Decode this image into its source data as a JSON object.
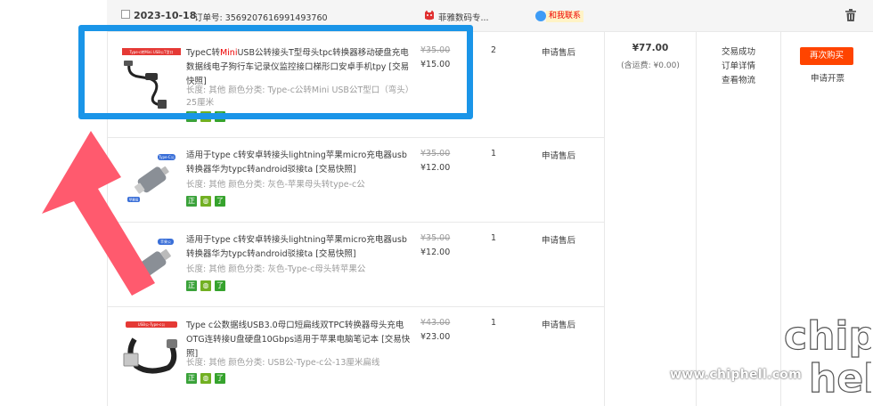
{
  "order": {
    "date": "2023-10-18",
    "number_label": "订单号: 3569207616991493760",
    "shop_name": "菲雅数码专...",
    "contact_label": "和我联系",
    "total": "¥77.00",
    "shipping": "(含运费: ¥0.00)",
    "status_lines": [
      "交易成功",
      "订单详情",
      "查看物流"
    ],
    "rebuy_label": "再次购买",
    "invoice_label": "申请开票"
  },
  "items": [
    {
      "title_pre": "TypeC转",
      "title_hl": "Mini",
      "title_post": "USB公转接头T型母头tpc转换器移动硬盘充电数据线电子狗行车记录仪监控接口梯形口安卓手机tpy [交易快照]",
      "spec": "长度: 其他  颜色分类: Type-c公转Mini USB公T型口（弯头）25厘米",
      "orig_price": "¥35.00",
      "price": "¥15.00",
      "qty": "2",
      "after_sale": "申请售后"
    },
    {
      "title_pre": "适用于type c转安卓转接头lightning苹果micro充电器usb转换器华为typc转android驳接ta [交易快照]",
      "title_hl": "",
      "title_post": "",
      "spec": "长度: 其他  颜色分类: 灰色-苹果母头转type-c公",
      "orig_price": "¥35.00",
      "price": "¥12.00",
      "qty": "1",
      "after_sale": "申请售后"
    },
    {
      "title_pre": "适用于type c转安卓转接头lightning苹果micro充电器usb转换器华为typc转android驳接ta [交易快照]",
      "title_hl": "",
      "title_post": "",
      "spec": "长度: 其他  颜色分类: 灰色-Type-c母头转苹果公",
      "orig_price": "¥35.00",
      "price": "¥12.00",
      "qty": "1",
      "after_sale": "申请售后"
    },
    {
      "title_pre": "Type c公数据线USB3.0母口短扁线双TPC转换器母头充电OTG连转接U盘硬盘10Gbps适用于苹果电脑笔记本 [交易快照]",
      "title_hl": "",
      "title_post": "",
      "spec": "长度: 其他  颜色分类: USB公-Type-c公-13厘米扁线",
      "orig_price": "¥43.00",
      "price": "¥23.00",
      "qty": "1",
      "after_sale": "申请售后"
    }
  ],
  "thumb_labels": [
    "Type-c转Mini USB公T型口",
    "Type-C公",
    "苹果母",
    "苹果公",
    "Type-c母",
    "USB公-Type-c公"
  ],
  "badge_glyphs": [
    "正",
    "◍",
    "了"
  ],
  "watermark": {
    "site": "www.chiphell.com",
    "logo": "chip hell"
  },
  "colors": {
    "accent_red": "#ff4400",
    "highlight_blue": "#1a95e8",
    "arrow_pink": "#ff5a6e",
    "strike_gray": "#9c9c9c"
  }
}
